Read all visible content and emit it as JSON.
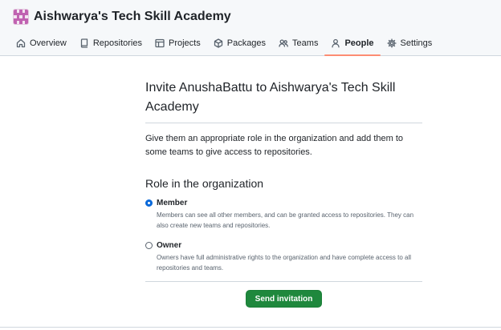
{
  "org": {
    "name": "Aishwarya's Tech Skill Academy"
  },
  "tabs": [
    {
      "label": "Overview",
      "icon": "home-icon"
    },
    {
      "label": "Repositories",
      "icon": "repo-icon"
    },
    {
      "label": "Projects",
      "icon": "table-icon"
    },
    {
      "label": "Packages",
      "icon": "package-icon"
    },
    {
      "label": "Teams",
      "icon": "people-icon"
    },
    {
      "label": "People",
      "icon": "person-icon",
      "active": true
    },
    {
      "label": "Settings",
      "icon": "gear-icon"
    }
  ],
  "invite": {
    "title": "Invite AnushaBattu to Aishwarya's Tech Skill Academy",
    "lead": "Give them an appropriate role in the organization and add them to some teams to give access to repositories.",
    "role_heading": "Role in the organization",
    "roles": [
      {
        "label": "Member",
        "selected": true,
        "description": "Members can see all other members, and can be granted access to repositories. They can also create new teams and repositories."
      },
      {
        "label": "Owner",
        "selected": false,
        "description": "Owners have full administrative rights to the organization and have complete access to all repositories and teams."
      }
    ],
    "submit_label": "Send invitation"
  },
  "colors": {
    "accent": "#0969da",
    "primary_button": "#1f883d",
    "active_tab_underline": "#fd8c73",
    "avatar": "#c062b1"
  }
}
